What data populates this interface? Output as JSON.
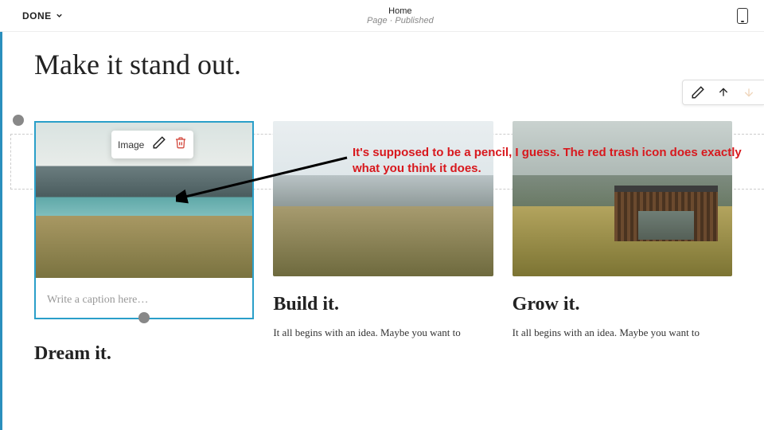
{
  "topbar": {
    "done_label": "DONE",
    "page_name": "Home",
    "page_status": "Page · Published"
  },
  "page": {
    "heading": "Make it stand out."
  },
  "image_toolbar": {
    "label": "Image"
  },
  "cards": [
    {
      "title": "Dream it.",
      "caption_placeholder": "Write a caption here…"
    },
    {
      "title": "Build it.",
      "body": "It all begins with an idea. Maybe you want to"
    },
    {
      "title": "Grow it.",
      "body": "It all begins with an idea. Maybe you want to"
    }
  ],
  "annotation": {
    "text": "It's supposed to be a pencil, I guess. The red trash icon does exactly what you think it does."
  },
  "icons": {
    "chevron_down": "chevron-down-icon",
    "device": "device-mobile-icon",
    "pencil": "pencil-icon",
    "trash": "trash-icon",
    "arrow_up": "arrow-up-icon",
    "arrow_down": "arrow-down-icon"
  },
  "colors": {
    "selection": "#2a9fc9",
    "annotation": "#d8181d",
    "trash": "#d44a3f"
  }
}
